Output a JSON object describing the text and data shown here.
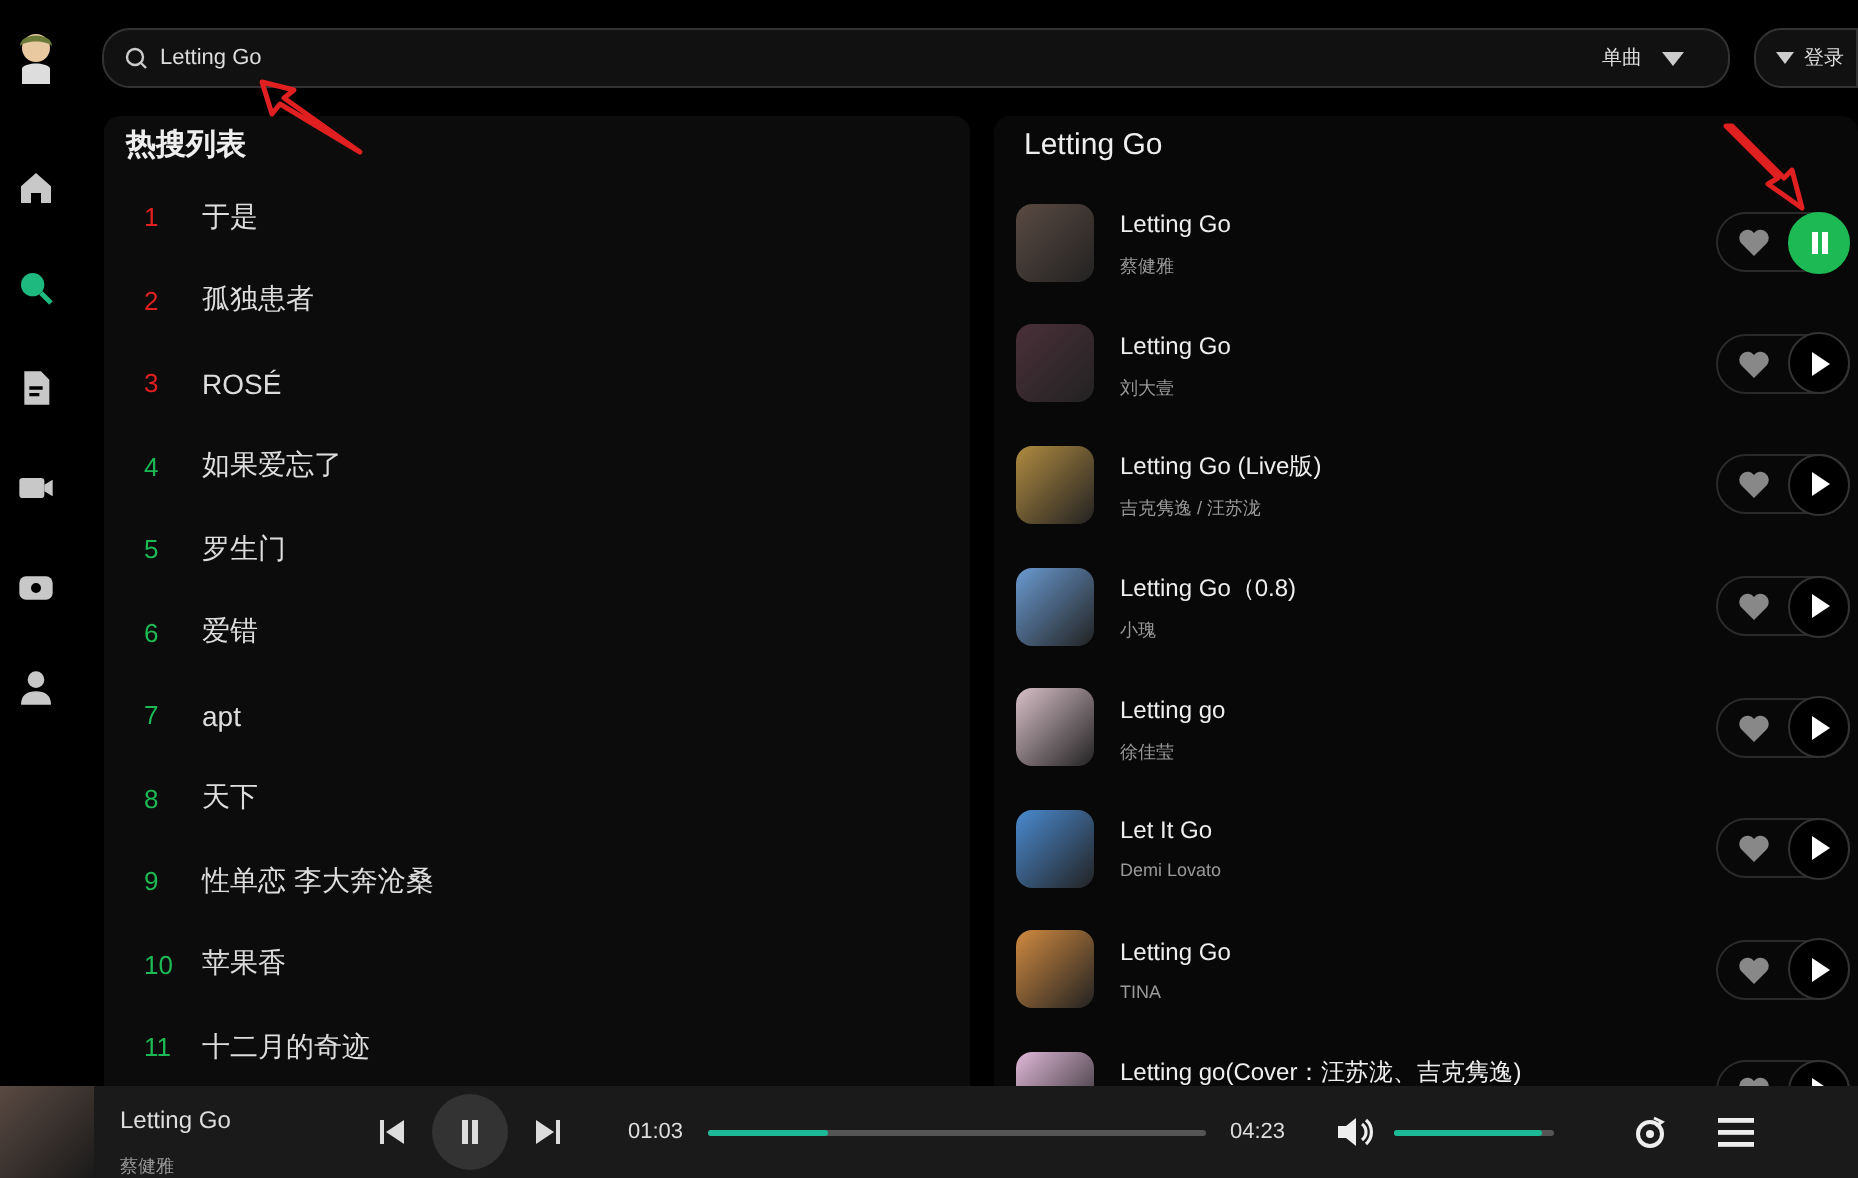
{
  "sidebar": {
    "items": [
      {
        "kind": "home",
        "selected": false
      },
      {
        "kind": "search",
        "selected": true
      },
      {
        "kind": "document",
        "selected": false
      },
      {
        "kind": "video",
        "selected": false
      },
      {
        "kind": "radio",
        "selected": false
      },
      {
        "kind": "user",
        "selected": false
      }
    ]
  },
  "search": {
    "value": "Letting Go",
    "type_filter": "单曲",
    "login": "登录"
  },
  "hot_list": {
    "title": "热搜列表",
    "items": [
      {
        "rank": "1",
        "text": "于是",
        "color": "#e02020"
      },
      {
        "rank": "2",
        "text": "孤独患者",
        "color": "#e02020"
      },
      {
        "rank": "3",
        "text": "ROSÉ",
        "color": "#e02020"
      },
      {
        "rank": "4",
        "text": "如果爱忘了",
        "color": "#1db954"
      },
      {
        "rank": "5",
        "text": "罗生门",
        "color": "#1db954"
      },
      {
        "rank": "6",
        "text": "爱错",
        "color": "#1db954"
      },
      {
        "rank": "7",
        "text": "apt",
        "color": "#1db954"
      },
      {
        "rank": "8",
        "text": "天下",
        "color": "#1db954"
      },
      {
        "rank": "9",
        "text": "性单恋 李大奔沧桑",
        "color": "#1db954"
      },
      {
        "rank": "10",
        "text": "苹果香",
        "color": "#1db954"
      },
      {
        "rank": "11",
        "text": "十二月的奇迹",
        "color": "#1db954"
      }
    ]
  },
  "results": {
    "title": "Letting Go",
    "songs": [
      {
        "title": "Letting Go",
        "artist": "蔡健雅",
        "playing": true
      },
      {
        "title": "Letting Go",
        "artist": "刘大壹",
        "playing": false
      },
      {
        "title": "Letting Go (Live版)",
        "artist": "吉克隽逸 / 汪苏泷",
        "playing": false
      },
      {
        "title": "Letting Go（0.8)",
        "artist": "小瑰",
        "playing": false
      },
      {
        "title": "Letting go",
        "artist": "徐佳莹",
        "playing": false
      },
      {
        "title": "Let It Go",
        "artist": "Demi Lovato",
        "playing": false
      },
      {
        "title": "Letting Go",
        "artist": "TINA",
        "playing": false
      },
      {
        "title": "Letting go(Cover：汪苏泷、吉克隽逸)",
        "playing": false
      }
    ]
  },
  "player": {
    "title": "Letting Go",
    "artist": "蔡健雅",
    "playing": true,
    "elapsed": "01:03",
    "duration": "04:23",
    "progress": {
      "level": 0.24
    },
    "volume": {
      "level": 0.93
    }
  }
}
